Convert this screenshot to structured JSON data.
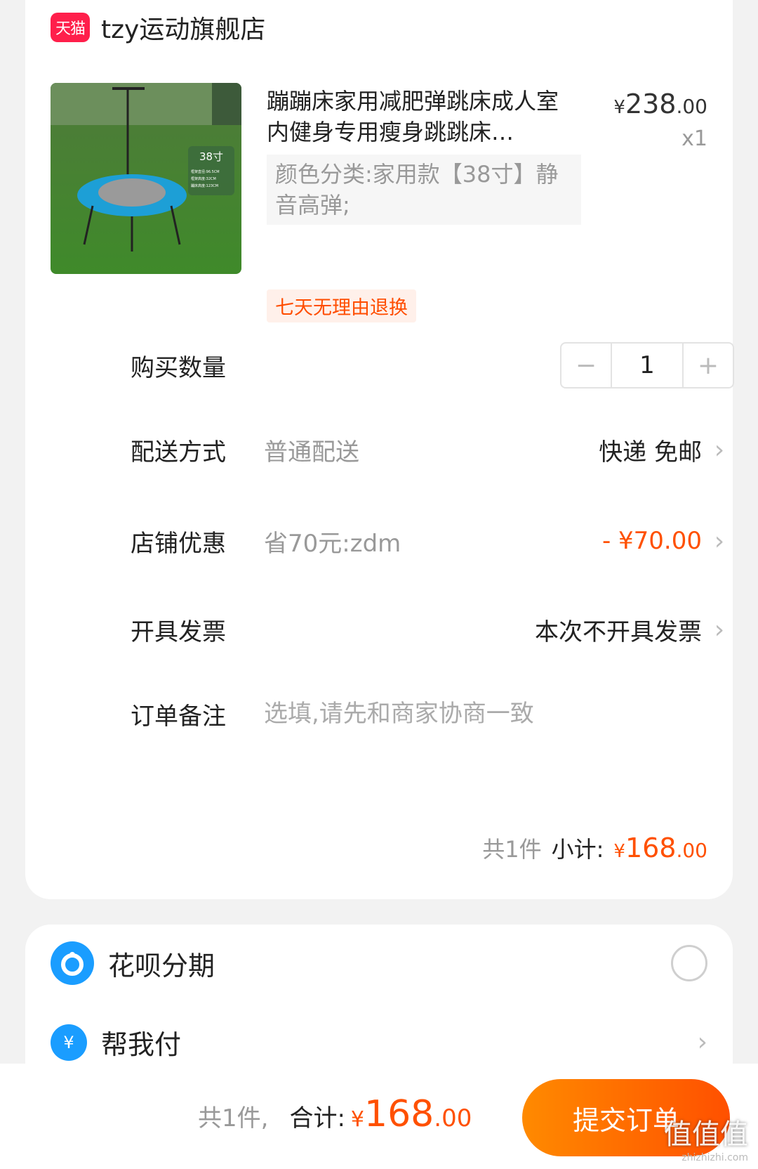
{
  "store": {
    "badge": "天猫",
    "name": "tzy运动旗舰店"
  },
  "product": {
    "title": "蹦蹦床家用减肥弹跳床成人室内健身专用瘦身跳跳床…",
    "price_currency": "¥",
    "price_int": "238",
    "price_dec": ".00",
    "qty_text": "x1",
    "sku_text": "颜色分类:家用款【38寸】静音高弹;",
    "tag": "七天无理由退换",
    "image_label": "38寸",
    "image_specs": [
      "框架直径:96.5CM",
      "框架高度:32CM",
      "蹦床高度:123CM"
    ]
  },
  "quantity": {
    "label": "购买数量",
    "value": "1",
    "minus": "−",
    "plus": "+"
  },
  "shipping": {
    "label": "配送方式",
    "sub": "普通配送",
    "value": "快递 免邮"
  },
  "discount": {
    "label": "店铺优惠",
    "sub": "省70元:zdm",
    "value": "- ¥70.00"
  },
  "invoice": {
    "label": "开具发票",
    "value": "本次不开具发票"
  },
  "remark": {
    "label": "订单备注",
    "placeholder": "选填,请先和商家协商一致"
  },
  "subtotal": {
    "count": "共1件",
    "label": "小计:",
    "currency": "¥",
    "int": "168",
    "dec": ".00"
  },
  "payment": {
    "huabei": {
      "label": "花呗分期"
    },
    "helppay": {
      "label": "帮我付"
    }
  },
  "footer": {
    "count": "共1件,",
    "label": "合计:",
    "currency": "¥",
    "int": "168",
    "dec": ".00",
    "submit": "提交订单",
    "watermark": "值值值",
    "watermark_url": "zhizhizhi.com"
  },
  "colors": {
    "accent": "#ff5000",
    "tmall": "#ff1f4b",
    "alipay": "#1a9dff"
  }
}
